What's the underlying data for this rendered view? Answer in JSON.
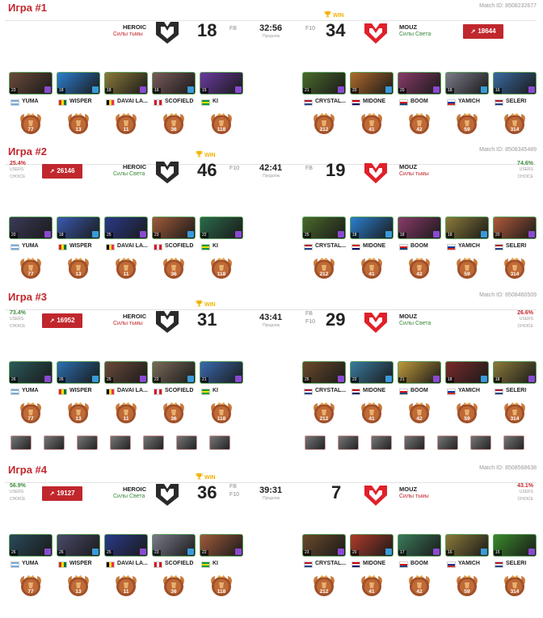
{
  "labels": {
    "fb": "FB",
    "f10": "F10",
    "win": "WIN",
    "prodol": "Продолж.",
    "users": "USERS",
    "choice": "CHOICE"
  },
  "teams": {
    "left": "HEROIC",
    "right": "MOUZ"
  },
  "sides": {
    "dark": "Силы тьмы",
    "light": "Силы Света"
  },
  "colors": {
    "accent": "#c0272d",
    "win": "#f0b400",
    "green": "#3c8c3c"
  },
  "games": [
    {
      "title": "Игра #1",
      "match_id": "Match ID: 8508232677",
      "left": {
        "name": "HEROIC",
        "side": "Силы тьмы",
        "score": "18",
        "tags": [
          "FB"
        ]
      },
      "right": {
        "name": "MOUZ",
        "side": "Силы Света",
        "score": "34",
        "tags": [
          "F10"
        ],
        "win": true
      },
      "timer": "32:56",
      "popularity": {
        "right": "18644"
      },
      "left_players": [
        {
          "name": "YUMA",
          "level": "23",
          "hue": "#6b4a3a"
        },
        {
          "name": "WISPER",
          "level": "18",
          "hue": "#2b7fd1"
        },
        {
          "name": "DAVAI LA...",
          "level": "18",
          "hue": "#8a7a3a"
        },
        {
          "name": "SCOFIELD",
          "level": "16",
          "hue": "#7a5a5a"
        },
        {
          "name": "KI",
          "level": "15",
          "hue": "#6a3aa0"
        }
      ],
      "right_players": [
        {
          "name": "CRYSTAL...",
          "level": "21",
          "hue": "#4a6a2a"
        },
        {
          "name": "MIDONE",
          "level": "20",
          "hue": "#b06a2a"
        },
        {
          "name": "BOOM",
          "level": "20",
          "hue": "#8a3a6a"
        },
        {
          "name": "YAMICH",
          "level": "18",
          "hue": "#7a7a8a"
        },
        {
          "name": "SELERI",
          "level": "16",
          "hue": "#3a6aa0"
        }
      ],
      "left_medals": [
        "77",
        "13",
        "11",
        "36",
        "118"
      ],
      "right_medals": [
        "212",
        "41",
        "42",
        "59",
        "314"
      ]
    },
    {
      "title": "Игра #2",
      "match_id": "Match ID: 8508345489",
      "left": {
        "name": "HEROIC",
        "side": "Силы Света",
        "score": "46",
        "tags": [
          "F10"
        ],
        "win": true,
        "users_pct": "25.4%"
      },
      "right": {
        "name": "MOUZ",
        "side": "Силы тьмы",
        "score": "19",
        "tags": [
          "FB"
        ],
        "users_pct": "74.6%"
      },
      "timer": "42:41",
      "popularity": {
        "left": "26146"
      },
      "left_players": [
        {
          "name": "YUMA",
          "level": "20",
          "hue": "#3a3a5a"
        },
        {
          "name": "WISPER",
          "level": "18",
          "hue": "#3a5ab0"
        },
        {
          "name": "DAVAI LA...",
          "level": "25",
          "hue": "#2a3a8a"
        },
        {
          "name": "SCOFIELD",
          "level": "23",
          "hue": "#a05a3a"
        },
        {
          "name": "KI",
          "level": "22",
          "hue": "#2a6a4a"
        }
      ],
      "right_players": [
        {
          "name": "CRYSTAL...",
          "level": "25",
          "hue": "#4a6a2a"
        },
        {
          "name": "MIDONE",
          "level": "18",
          "hue": "#2b7fd1"
        },
        {
          "name": "BOOM",
          "level": "18",
          "hue": "#8a3a6a"
        },
        {
          "name": "YAMICH",
          "level": "18",
          "hue": "#8a7a3a"
        },
        {
          "name": "SELERI",
          "level": "20",
          "hue": "#b05a3a"
        }
      ],
      "left_medals": [
        "77",
        "13",
        "11",
        "36",
        "118"
      ],
      "right_medals": [
        "212",
        "41",
        "42",
        "59",
        "314"
      ]
    },
    {
      "title": "Игра #3",
      "match_id": "Match ID: 8508460509",
      "left": {
        "name": "HEROIC",
        "side": "Силы тьмы",
        "score": "31",
        "tags": [],
        "win": true,
        "users_pct": "73.4%"
      },
      "right": {
        "name": "MOUZ",
        "side": "Силы Света",
        "score": "29",
        "tags": [
          "FB",
          "F10"
        ],
        "users_pct": "26.6%"
      },
      "timer": "43:41",
      "popularity": {
        "left": "16952"
      },
      "left_players": [
        {
          "name": "YUMA",
          "level": "26",
          "hue": "#2a5a5a"
        },
        {
          "name": "WISPER",
          "level": "26",
          "hue": "#2b6fb1"
        },
        {
          "name": "DAVAI LA...",
          "level": "25",
          "hue": "#6a4a3a"
        },
        {
          "name": "SCOFIELD",
          "level": "22",
          "hue": "#7a6a5a"
        },
        {
          "name": "KI",
          "level": "21",
          "hue": "#3a6ab0"
        }
      ],
      "right_players": [
        {
          "name": "CRYSTAL...",
          "level": "25",
          "hue": "#6a4a2a"
        },
        {
          "name": "MIDONE",
          "level": "22",
          "hue": "#3a7aa0"
        },
        {
          "name": "BOOM",
          "level": "21",
          "hue": "#c09a3a"
        },
        {
          "name": "YAMICH",
          "level": "18",
          "hue": "#7a2a2a"
        },
        {
          "name": "SELERI",
          "level": "18",
          "hue": "#8a7a3a"
        }
      ],
      "left_medals": [
        "77",
        "13",
        "11",
        "36",
        "118"
      ],
      "right_medals": [
        "212",
        "41",
        "42",
        "59",
        "314"
      ],
      "bans": 7
    },
    {
      "title": "Игра #4",
      "match_id": "Match ID: 8508568638",
      "left": {
        "name": "HEROIC",
        "side": "Силы Света",
        "score": "36",
        "tags": [
          "FB",
          "F10"
        ],
        "win": true,
        "users_pct": "56.9%"
      },
      "right": {
        "name": "MOUZ",
        "side": "Силы тьмы",
        "score": "7",
        "tags": [],
        "users_pct": "43.1%"
      },
      "timer": "39:31",
      "popularity": {
        "left": "19127"
      },
      "left_players": [
        {
          "name": "YUMA",
          "level": "26",
          "hue": "#2a4a5a"
        },
        {
          "name": "WISPER",
          "level": "26",
          "hue": "#4a4a6a"
        },
        {
          "name": "DAVAI LA...",
          "level": "25",
          "hue": "#2a3a8a"
        },
        {
          "name": "SCOFIELD",
          "level": "23",
          "hue": "#7a7a8a"
        },
        {
          "name": "KI",
          "level": "22",
          "hue": "#a05a3a"
        }
      ],
      "right_players": [
        {
          "name": "CRYSTAL...",
          "level": "23",
          "hue": "#6a4a2a"
        },
        {
          "name": "MIDONE",
          "level": "20",
          "hue": "#b03a2a"
        },
        {
          "name": "BOOM",
          "level": "17",
          "hue": "#3a7a5a"
        },
        {
          "name": "YAMICH",
          "level": "16",
          "hue": "#8a7a3a"
        },
        {
          "name": "SELERI",
          "level": "15",
          "hue": "#3a8a2a"
        }
      ],
      "left_medals": [
        "77",
        "13",
        "11",
        "36",
        "118"
      ],
      "right_medals": [
        "212",
        "41",
        "42",
        "59",
        "314"
      ]
    }
  ]
}
